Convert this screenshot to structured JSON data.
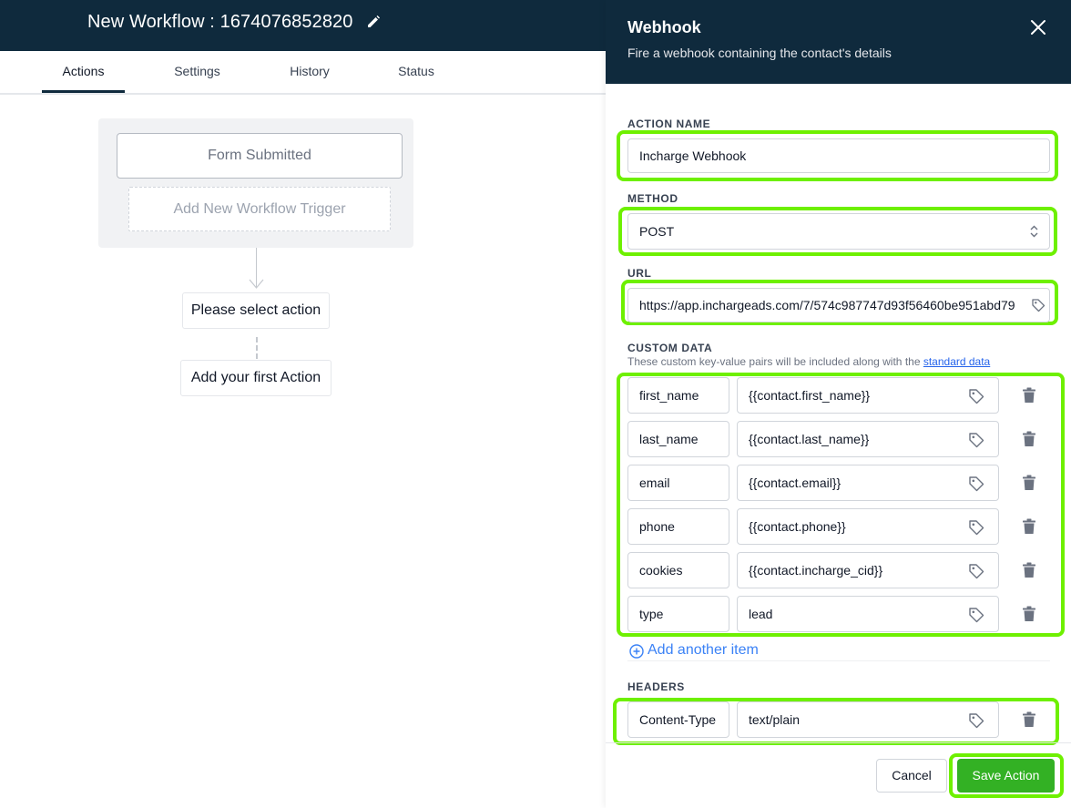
{
  "workflow": {
    "title": "New Workflow : 1674076852820",
    "edit_icon": "pencil-icon",
    "tabs": [
      {
        "label": "Actions",
        "active": true
      },
      {
        "label": "Settings",
        "active": false
      },
      {
        "label": "History",
        "active": false
      },
      {
        "label": "Status",
        "active": false
      }
    ],
    "trigger": "Form Submitted",
    "add_trigger": "Add New Workflow Trigger",
    "select_action": "Please select action",
    "add_first_action": "Add your first Action"
  },
  "panel": {
    "title": "Webhook",
    "subtitle": "Fire a webhook containing the contact's details",
    "close_icon": "close-icon",
    "action_name": {
      "label": "ACTION NAME",
      "value": "Incharge Webhook"
    },
    "method": {
      "label": "METHOD",
      "value": "POST"
    },
    "url": {
      "label": "URL",
      "value": "https://app.inchargeads.com/7/574c987747d93f56460be951abd79"
    },
    "custom_data": {
      "label": "CUSTOM DATA",
      "hint": "These custom key-value pairs will be included along with the",
      "hint_link": "standard data",
      "rows": [
        {
          "key": "first_name",
          "value": "{{contact.first_name}}"
        },
        {
          "key": "last_name",
          "value": "{{contact.last_name}}"
        },
        {
          "key": "email",
          "value": "{{contact.email}}"
        },
        {
          "key": "phone",
          "value": "{{contact.phone}}"
        },
        {
          "key": "cookies",
          "value": "{{contact.incharge_cid}}"
        },
        {
          "key": "type",
          "value": "lead"
        }
      ],
      "add_label": "Add another item"
    },
    "headers": {
      "label": "HEADERS",
      "rows": [
        {
          "key": "Content-Type",
          "value": "text/plain"
        }
      ]
    },
    "cancel_label": "Cancel",
    "save_label": "Save Action"
  },
  "colors": {
    "header_bg": "#0f2a3d",
    "highlight": "#6ef000",
    "save_button": "#33b124",
    "link": "#3b82f6"
  }
}
